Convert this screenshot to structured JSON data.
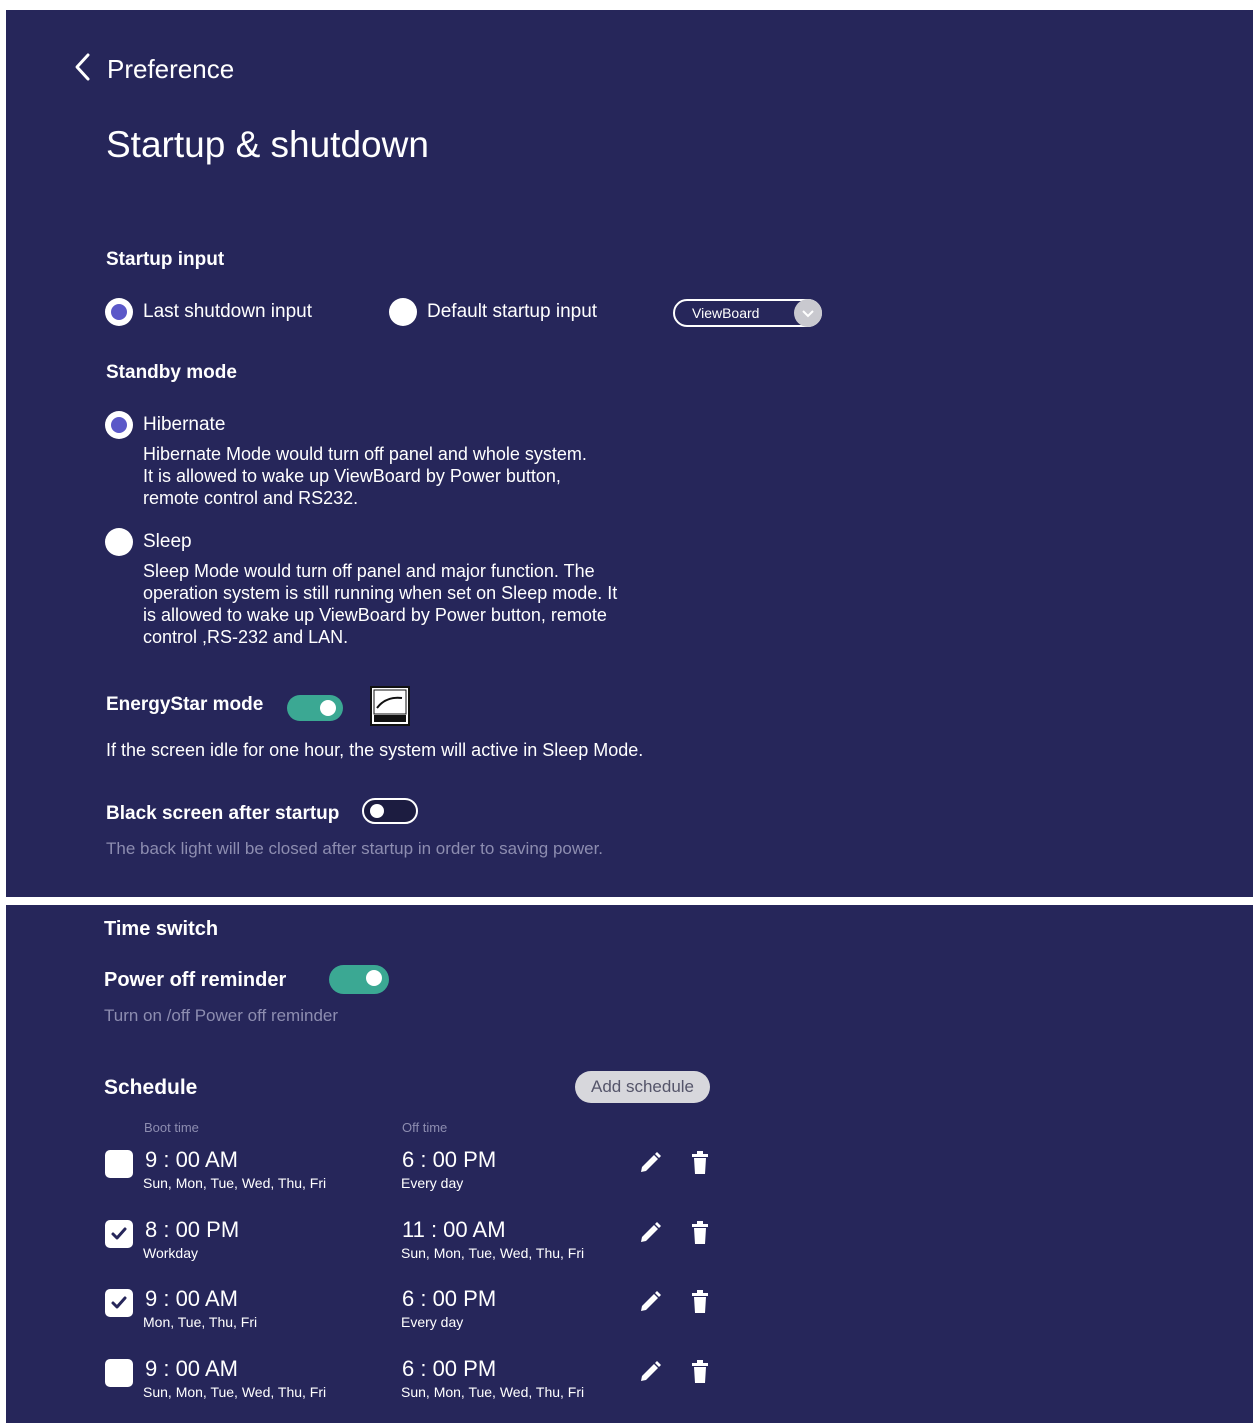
{
  "header": {
    "back_label": "Preference",
    "title": "Startup & shutdown"
  },
  "startup_input": {
    "heading": "Startup input",
    "options": [
      {
        "label": "Last shutdown input",
        "selected": true
      },
      {
        "label": "Default startup input",
        "selected": false
      }
    ],
    "source_select": {
      "value": "ViewBoard"
    }
  },
  "standby_mode": {
    "heading": "Standby mode",
    "options": [
      {
        "label": "Hibernate",
        "selected": true,
        "description": [
          "Hibernate Mode would turn off panel and whole system.",
          "It is allowed to wake up ViewBoard by Power button,",
          "remote control and RS232."
        ]
      },
      {
        "label": "Sleep",
        "selected": false,
        "description": [
          "Sleep Mode would turn off panel and major function. The",
          "operation system is still running when set on Sleep mode. It",
          "is allowed to wake up ViewBoard by Power button, remote",
          "control ,RS-232 and LAN."
        ]
      }
    ]
  },
  "energystar": {
    "label": "EnergyStar mode",
    "enabled": true,
    "description": "If the screen idle for one hour, the system will active in Sleep Mode."
  },
  "black_screen": {
    "label": "Black screen after startup",
    "enabled": false,
    "description": "The back light will be closed after startup in order to saving power."
  },
  "time_switch": {
    "heading": "Time switch",
    "power_off_reminder": {
      "label": "Power off reminder",
      "enabled": true,
      "description": "Turn on /off Power off reminder"
    }
  },
  "schedule": {
    "heading": "Schedule",
    "add_label": "Add schedule",
    "col_boot": "Boot time",
    "col_off": "Off time",
    "rows": [
      {
        "checked": false,
        "boot": "9 : 00 AM",
        "boot_days": "Sun, Mon, Tue, Wed, Thu, Fri",
        "off": "6 : 00 PM",
        "off_days": "Every day"
      },
      {
        "checked": true,
        "boot": "8 : 00 PM",
        "boot_days": "Workday",
        "off": "11 : 00 AM",
        "off_days": "Sun, Mon, Tue, Wed, Thu, Fri"
      },
      {
        "checked": true,
        "boot": "9 : 00 AM",
        "boot_days": "Mon, Tue, Thu, Fri",
        "off": "6 : 00 PM",
        "off_days": "Every day"
      },
      {
        "checked": false,
        "boot": "9 : 00 AM",
        "boot_days": "Sun, Mon, Tue, Wed, Thu, Fri",
        "off": "6 : 00 PM",
        "off_days": "Sun, Mon, Tue, Wed, Thu, Fri"
      }
    ]
  },
  "icons": {
    "back": "chevron-left-icon",
    "edit": "pencil-icon",
    "delete": "trash-icon",
    "energystar": "energy-star-logo"
  },
  "colors": {
    "background": "#26265a",
    "toggle_on": "#3ba893",
    "radio_selected": "#5b58c8",
    "dim_text": "#8d8db0"
  }
}
